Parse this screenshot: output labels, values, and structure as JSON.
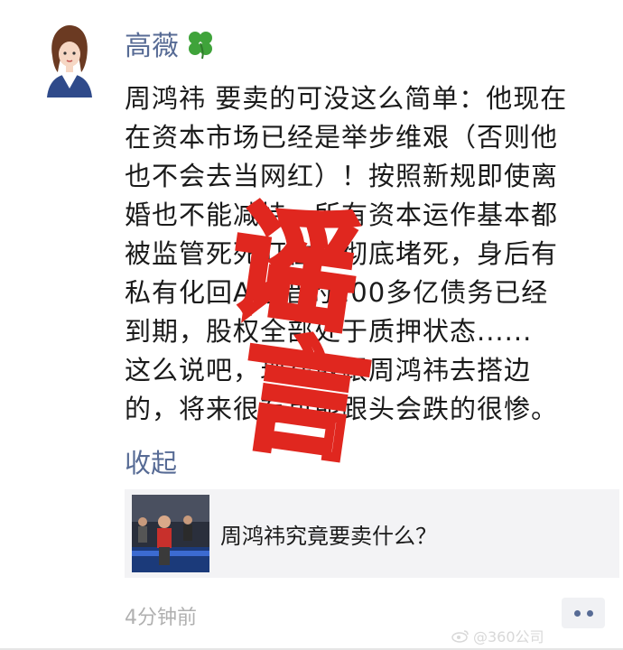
{
  "post": {
    "author": "高薇",
    "author_emoji_icon": "four-leaf-clover-icon",
    "text_lines": [
      "周鸿祎 要卖的可没这么简单：他现在",
      "在资本市场已经是举步维艰（否则他",
      "也不会去当网红）！按照新规即使离",
      "婚也不能减持，所有资本运作基本都",
      "被监管死死盯住，彻底堵死，身后有",
      "私有化回A时借的200多亿债务已经",
      "到期，股权全部处于质押状态......",
      "这么说吧，现在敢跟周鸿祎去搭边",
      "的，将来很有可能跟头会跌的很惨。"
    ],
    "collapse_label": "收起",
    "link_card": {
      "title": "周鸿祎究竟要卖什么？"
    },
    "time": "4分钟前",
    "more_icon": "more-dots-icon"
  },
  "stamp": {
    "text": "谣言",
    "color": "#e0271f"
  },
  "watermark": {
    "text": "@360公司",
    "icon": "weibo-icon"
  },
  "colors": {
    "link_blue": "#576b95",
    "card_bg": "#f3f3f5",
    "time_gray": "#b0b0b0"
  }
}
